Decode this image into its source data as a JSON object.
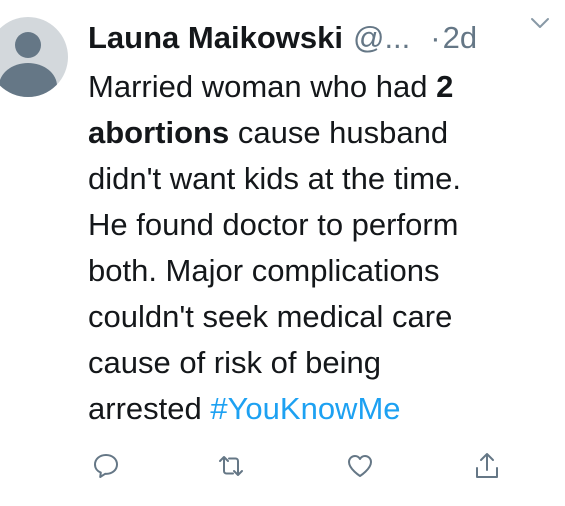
{
  "tweet": {
    "author_name": "Launa Maikowski",
    "handle": "@...",
    "separator": "·",
    "timestamp": "2d",
    "text_lines": [
      "Married woman who had ",
      "2",
      "abortions",
      " cause husband",
      "didn't want kids at the time.",
      "He found doctor to perform",
      "both. Major complications",
      "couldn't seek medical care",
      "cause of risk of being",
      "arrested ",
      "#YouKnowMe"
    ]
  },
  "icons": {
    "caret": "chevron-down-icon",
    "reply": "reply-icon",
    "retweet": "retweet-icon",
    "like": "heart-icon",
    "share": "share-icon"
  },
  "colors": {
    "text": "#14171a",
    "secondary": "#657786",
    "link": "#1da1f2",
    "avatar_bg": "#d3d8dc",
    "avatar_fg": "#657786"
  }
}
